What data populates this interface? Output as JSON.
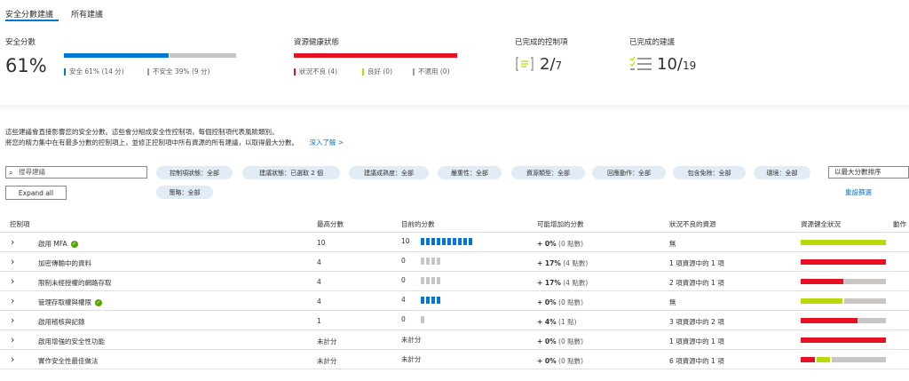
{
  "tabs": [
    {
      "label": "安全分數建議"
    },
    {
      "label": "所有建議"
    }
  ],
  "summary": {
    "secure_score": {
      "label": "安全分數",
      "value": "61%",
      "healthy_legend": "安全 61% (14 分)",
      "unhealthy_legend": "不安全 39% (9 分)",
      "healthy_fraction": 0.61
    },
    "resource_health": {
      "label": "資源健康狀態",
      "unhealthy_legend": "狀況不良 (4)",
      "healthy_legend": "良好 (0)",
      "na_legend": "不適用 (0)"
    },
    "controls": {
      "label": "已完成的控制項",
      "value": "2/",
      "total": "7"
    },
    "recommendations": {
      "label": "已完成的建議",
      "value": "10/",
      "total": "19"
    }
  },
  "description": {
    "line1": "這些建議會直接影響您的安全分數。這些會分組成安全性控制項，每個控制項代表風險類別。",
    "line2": "將您的精力集中在有最多分數的控制項上，並修正控制項中所有資源的所有建議，以取得最大分數。",
    "link": "深入了解 >"
  },
  "search": {
    "placeholder": "搜尋建議"
  },
  "filters": [
    "控制項狀態：全部",
    "建議狀態：已選取 2 個",
    "建議成熟度：全部",
    "嚴重性：全部",
    "資源類型：全部",
    "回應動作：全部",
    "包含免除：全部",
    "環境：全部",
    "策略：全部"
  ],
  "sort": {
    "label": "以最大分數排序"
  },
  "expand_all": "Expand all",
  "reset_filters": "重設篩選",
  "columns": [
    "控制項",
    "最高分數",
    "目前的分數",
    "可能增加的分數",
    "狀況不良的資源",
    "資源健全狀況",
    "動作"
  ],
  "rows": [
    {
      "name": "啟用 MFA",
      "done": true,
      "max": "10",
      "current": "10",
      "segments_filled": 10,
      "segments_total": 10,
      "increase": "+ 0%",
      "points": "(0 點數)",
      "unhealthy": "無",
      "health": {
        "red": 0,
        "green": 1,
        "gray": 0
      }
    },
    {
      "name": "加密傳輸中的資料",
      "done": false,
      "max": "4",
      "current": "0",
      "segments_filled": 0,
      "segments_total": 4,
      "increase": "+ 17%",
      "points": "(4 點數)",
      "unhealthy": "1 項資源中的 1 項",
      "health": {
        "red": 1,
        "green": 0,
        "gray": 0
      }
    },
    {
      "name": "限制未經授權的網路存取",
      "done": false,
      "max": "4",
      "current": "0",
      "segments_filled": 0,
      "segments_total": 4,
      "increase": "+ 17%",
      "points": "(4 點數)",
      "unhealthy": "2 項資源中的 1 項",
      "health": {
        "red": 0.5,
        "green": 0,
        "gray": 0.5
      }
    },
    {
      "name": "管理存取權與權限",
      "done": true,
      "max": "4",
      "current": "4",
      "segments_filled": 4,
      "segments_total": 4,
      "increase": "+ 0%",
      "points": "(0 點數)",
      "unhealthy": "無",
      "health": {
        "red": 0,
        "green": 0.5,
        "gray": 0.5
      }
    },
    {
      "name": "啟用稽核與記錄",
      "done": false,
      "max": "1",
      "current": "0",
      "segments_filled": 0,
      "segments_total": 1,
      "increase": "+ 4%",
      "points": "(1 點)",
      "unhealthy": "3 項資源中的 2 項",
      "health": {
        "red": 0.67,
        "green": 0,
        "gray": 0.33
      }
    },
    {
      "name": "啟用增強的安全性功能",
      "done": false,
      "max": "未計分",
      "current": "未計分",
      "segments_filled": 0,
      "segments_total": 0,
      "increase": "+ 0%",
      "points": "(0 點數)",
      "unhealthy": "1 項資源中的 1 項",
      "health": {
        "red": 1,
        "green": 0,
        "gray": 0
      }
    },
    {
      "name": "實作安全性最佳做法",
      "done": false,
      "max": "未計分",
      "current": "未計分",
      "segments_filled": 0,
      "segments_total": 0,
      "increase": "+ 0%",
      "points": "(0 點數)",
      "unhealthy": "6 項資源中的 1 項",
      "health": {
        "red": 0.17,
        "green": 0.17,
        "gray": 0.66
      }
    }
  ],
  "colors": {
    "accent": "#0078d4",
    "healthy": "#bad80a",
    "unhealthy": "#e81123",
    "neutral": "#c8c6c4",
    "check": "#57a300"
  }
}
